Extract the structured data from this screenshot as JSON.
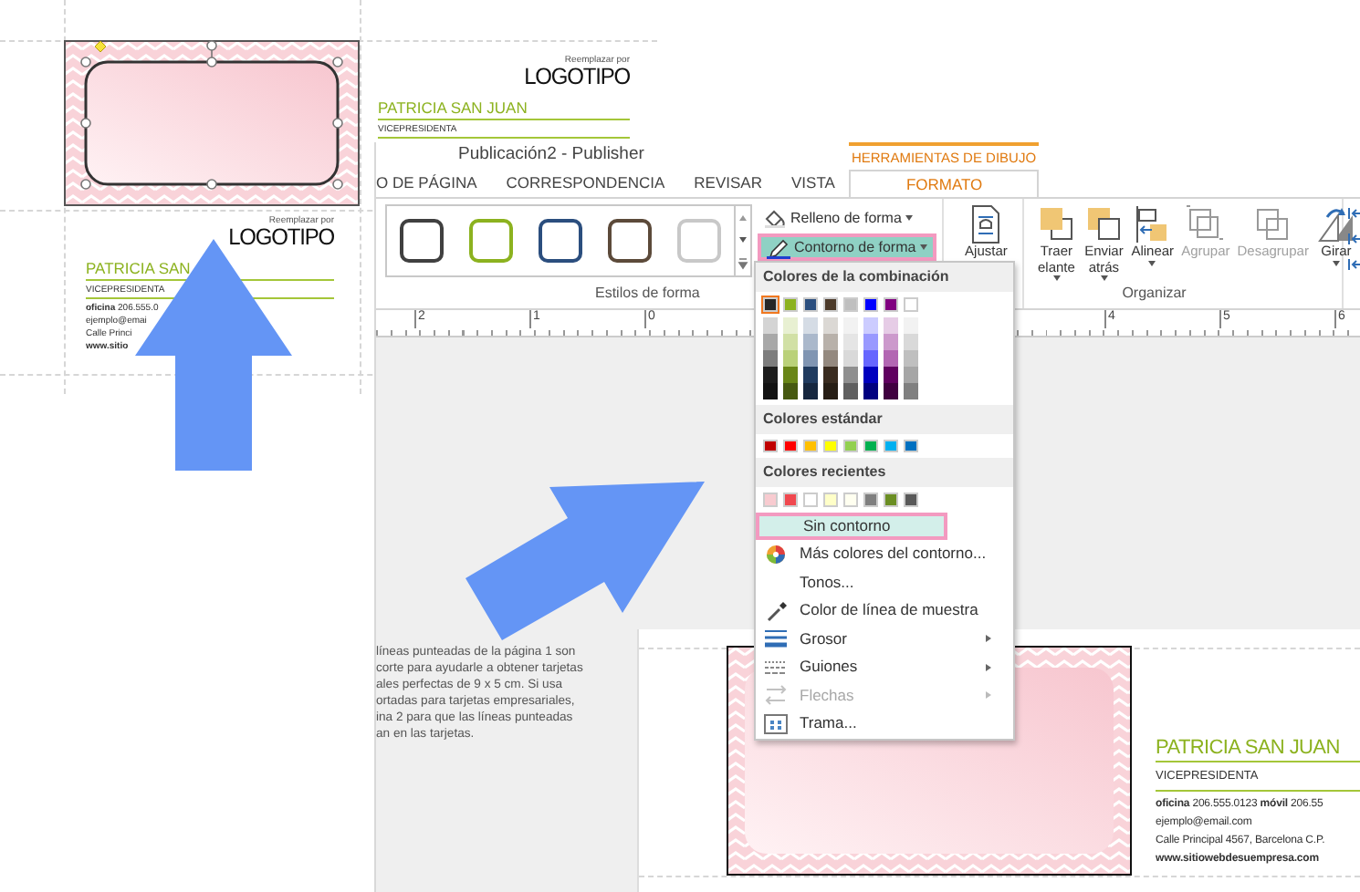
{
  "sheet": {
    "top_card": {
      "logo_caption": "Reemplazar por",
      "logo": "LOGOTIPO",
      "name": "PATRICIA SAN JUAN",
      "title": "VICEPRESIDENTA",
      "shape_selected": true
    },
    "lower_card": {
      "logo_caption": "Reemplazar por",
      "logo": "LOGOTIPO",
      "name": "PATRICIA SAN",
      "title": "VICEPRESIDENTA",
      "contact_lines": [
        "**oficina** 206.555.0",
        "ejemplo@emai",
        "Calle Princi",
        "**www.sitio**"
      ]
    }
  },
  "window": {
    "title": "Publicación2 - Publisher",
    "context_tab": "HERRAMIENTAS DE DIBUJO",
    "tabs": [
      {
        "label": "O DE PÁGINA",
        "selected": false
      },
      {
        "label": "CORRESPONDENCIA",
        "selected": false
      },
      {
        "label": "REVISAR",
        "selected": false
      },
      {
        "label": "VISTA",
        "selected": false
      },
      {
        "label": "FORMATO",
        "selected": true
      }
    ],
    "ribbon": {
      "shape_styles": [
        {
          "color": "#404040"
        },
        {
          "color": "#8cb21f"
        },
        {
          "color": "#2b4e7e"
        },
        {
          "color": "#5c4a3a"
        },
        {
          "color": "#c8c8c8"
        }
      ],
      "shape_styles_label": "Estilos de forma",
      "fill_button": "Relleno de forma",
      "outline_button": {
        "label": "Contorno de forma",
        "highlighted": true
      },
      "wrap_button": "Ajustar",
      "arrange_buttons": [
        {
          "kind": "front",
          "lines": [
            "Traer",
            "elante"
          ],
          "dropdown": true,
          "disabled": false
        },
        {
          "kind": "back",
          "lines": [
            "Enviar",
            "atrás"
          ],
          "dropdown": true,
          "disabled": false
        },
        {
          "kind": "align",
          "lines": [
            "Alinear"
          ],
          "dropdown": true,
          "disabled": false
        },
        {
          "kind": "group",
          "lines": [
            "Agrupar"
          ],
          "dropdown": false,
          "disabled": true
        },
        {
          "kind": "ungroup",
          "lines": [
            "Desagrupar"
          ],
          "dropdown": false,
          "disabled": true
        },
        {
          "kind": "rotate",
          "lines": [
            "Girar"
          ],
          "dropdown": true,
          "disabled": false
        }
      ],
      "arrange_label": "Organizar"
    },
    "ruler": {
      "left_numbers": [
        "2",
        "1",
        "0"
      ],
      "right_numbers": [
        "4",
        "5",
        "6"
      ]
    },
    "note_lines": [
      "líneas punteadas de la página 1 son",
      "corte para ayudarle a obtener tarjetas",
      "ales perfectas de 9 x 5 cm. Si usa",
      "ortadas para tarjetas empresariales,",
      "ina 2 para que las líneas punteadas",
      "an en las tarjetas."
    ],
    "page_card": {
      "name": "PATRICIA SAN JUAN",
      "title": "VICEPRESIDENTA",
      "contact_lines": [
        "**oficina** 206.555.0123  **móvil** 206.55",
        "ejemplo@email.com",
        "Calle Principal 4567, Barcelona C.P.",
        "**www.sitiowebdesuempresa.com**"
      ]
    },
    "outline_menu": {
      "sections": [
        {
          "heading": "Colores de la combinación",
          "shades": true,
          "swatches": [
            {
              "color": "#262626",
              "selected": true
            },
            {
              "color": "#8cb21f",
              "selected": false
            },
            {
              "color": "#2b4e7e",
              "selected": false
            },
            {
              "color": "#4d3b2a",
              "selected": false
            },
            {
              "color": "#bfbfbf",
              "selected": false
            },
            {
              "color": "#0000ff",
              "selected": false
            },
            {
              "color": "#800080",
              "selected": false
            },
            {
              "color": "#ffffff",
              "selected": false
            }
          ]
        },
        {
          "heading": "Colores estándar",
          "shades": false,
          "swatches": [
            {
              "color": "#c00000",
              "selected": false
            },
            {
              "color": "#ff0000",
              "selected": false
            },
            {
              "color": "#ffc000",
              "selected": false
            },
            {
              "color": "#ffff00",
              "selected": false
            },
            {
              "color": "#92d050",
              "selected": false
            },
            {
              "color": "#00b050",
              "selected": false
            },
            {
              "color": "#00b0f0",
              "selected": false
            },
            {
              "color": "#0070c0",
              "selected": false
            }
          ]
        },
        {
          "heading": "Colores recientes",
          "shades": false,
          "swatches": [
            {
              "color": "#f8cbd0",
              "selected": false
            },
            {
              "color": "#f0484f",
              "selected": false
            },
            {
              "color": "#ffffff",
              "selected": false
            },
            {
              "color": "#ffffc8",
              "selected": false
            },
            {
              "color": "#fffff0",
              "selected": false
            },
            {
              "color": "#7f7f7f",
              "selected": false
            },
            {
              "color": "#6b8e23",
              "selected": false
            },
            {
              "color": "#595959",
              "selected": false
            }
          ]
        }
      ],
      "items": [
        {
          "kind": "none",
          "label": "Sin contorno",
          "highlighted": true,
          "submenu": false,
          "disabled": false
        },
        {
          "kind": "colors",
          "label": "Más colores del contorno...",
          "highlighted": false,
          "submenu": false,
          "disabled": false
        },
        {
          "kind": "plain",
          "label": "Tonos...",
          "highlighted": false,
          "submenu": false,
          "disabled": false
        },
        {
          "kind": "eyedropper",
          "label": "Color de línea de muestra",
          "highlighted": false,
          "submenu": false,
          "disabled": false
        },
        {
          "kind": "weight",
          "label": "Grosor",
          "highlighted": false,
          "submenu": true,
          "disabled": false
        },
        {
          "kind": "dashes",
          "label": "Guiones",
          "highlighted": false,
          "submenu": true,
          "disabled": false
        },
        {
          "kind": "arrows",
          "label": "Flechas",
          "highlighted": false,
          "submenu": true,
          "disabled": true
        },
        {
          "kind": "pattern",
          "label": "Trama...",
          "highlighted": false,
          "submenu": false,
          "disabled": false
        }
      ]
    }
  }
}
